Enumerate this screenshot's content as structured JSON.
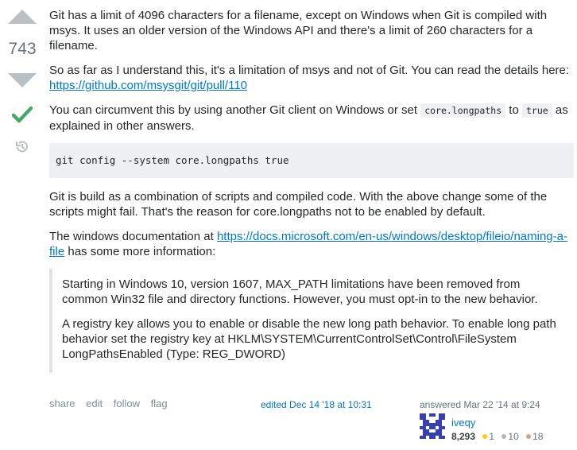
{
  "votes": {
    "count": "743"
  },
  "post": {
    "p1": "Git has a limit of 4096 characters for a filename, except on Windows when Git is compiled with msys. It uses an older version of the Windows API and there's a limit of 260 characters for a filename.",
    "p2_text": "So as far as I understand this, it's a limitation of msys and not of Git. You can read the details here: ",
    "p2_link": "https://github.com/msysgit/git/pull/110",
    "p3_a": "You can circumvent this by using another Git client on Windows or set ",
    "p3_code1": "core.longpaths",
    "p3_b": " to ",
    "p3_code2": "true",
    "p3_c": " as explained in other answers.",
    "code_block": "git config --system core.longpaths true",
    "p4": "Git is build as a combination of scripts and compiled code. With the above change some of the scripts might fail. That's the reason for core.longpaths not to be enabled by default.",
    "p5_a": "The windows documentation at ",
    "p5_link": "https://docs.microsoft.com/en-us/windows/desktop/fileio/naming-a-file",
    "p5_b": " has some more information:",
    "quote_p1": "Starting in Windows 10, version 1607, MAX_PATH limitations have been removed from common Win32 file and directory functions. However, you must opt-in to the new behavior.",
    "quote_p2": "A registry key allows you to enable or disable the new long path behavior. To enable long path behavior set the registry key at HKLM\\SYSTEM\\CurrentControlSet\\Control\\FileSystem LongPathsEnabled (Type: REG_DWORD)"
  },
  "footer": {
    "share": "share",
    "edit": "edit",
    "follow": "follow",
    "flag": "flag",
    "edited": "edited Dec 14 '18 at 10:31",
    "answered": "answered Mar 22 '14 at 9:24",
    "username": "iveqy",
    "reputation": "8,293",
    "gold": "1",
    "silver": "10",
    "bronze": "18"
  },
  "colors": {
    "gold": "#ffcc01",
    "silver": "#b4b8bc",
    "bronze": "#d1a684",
    "accepted": "#48a868"
  }
}
